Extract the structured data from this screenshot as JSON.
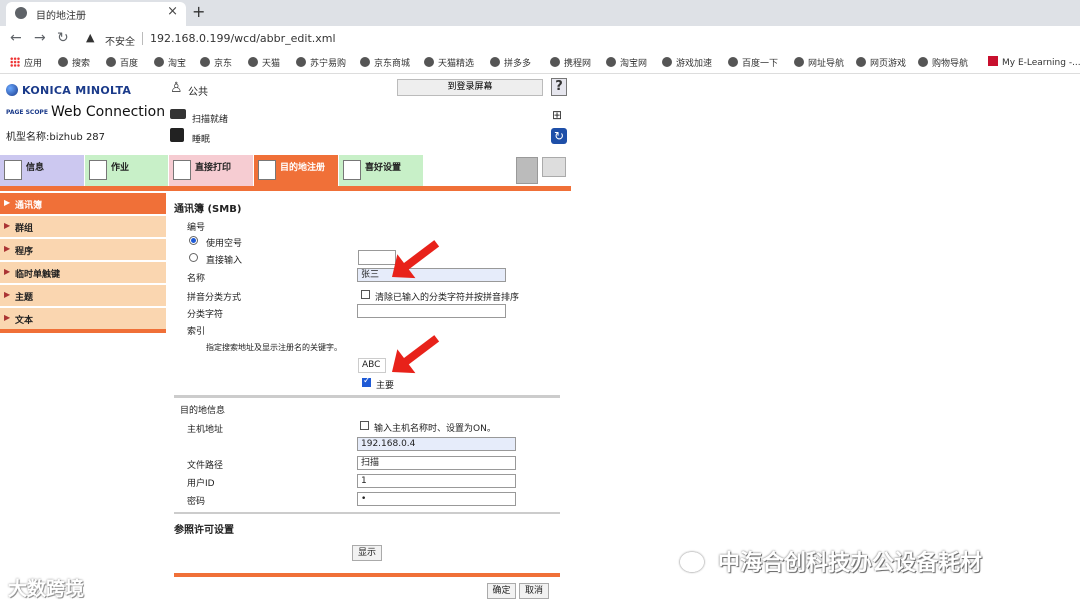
{
  "browser": {
    "tab_title": "目的地注册",
    "tab_close": "×",
    "new_tab": "+",
    "insecure_label": "不安全",
    "url": "192.168.0.199/wcd/abbr_edit.xml",
    "nav": {
      "back": "←",
      "forward": "→",
      "reload": "↻",
      "warning": "▲"
    }
  },
  "bookmarks": [
    {
      "label": "应用",
      "icon": "apps-icon"
    },
    {
      "label": "搜索",
      "icon": "globe-icon"
    },
    {
      "label": "百度",
      "icon": "globe-icon"
    },
    {
      "label": "淘宝",
      "icon": "globe-icon"
    },
    {
      "label": "京东",
      "icon": "globe-icon"
    },
    {
      "label": "天猫",
      "icon": "globe-icon"
    },
    {
      "label": "苏宁易购",
      "icon": "globe-icon"
    },
    {
      "label": "京东商城",
      "icon": "globe-icon"
    },
    {
      "label": "天猫精选",
      "icon": "globe-icon"
    },
    {
      "label": "拼多多",
      "icon": "globe-icon"
    },
    {
      "label": "携程网",
      "icon": "globe-icon"
    },
    {
      "label": "淘宝网",
      "icon": "globe-icon"
    },
    {
      "label": "游戏加速",
      "icon": "globe-icon"
    },
    {
      "label": "百度一下",
      "icon": "globe-icon"
    },
    {
      "label": "网址导航",
      "icon": "globe-icon"
    },
    {
      "label": "网页游戏",
      "icon": "globe-icon"
    },
    {
      "label": "购物导航",
      "icon": "globe-icon"
    },
    {
      "label": "My E-Learning -...",
      "icon": "elearning-icon"
    }
  ],
  "header": {
    "brand": "KONICA MINOLTA",
    "pagescope": "PAGE SCOPE",
    "product": "Web Connection",
    "model": "机型名称:bizhub 287",
    "user": "公共",
    "to_login": "到登录屏幕",
    "help": "?",
    "scan_status": "扫描就绪",
    "print_status": "睡眠"
  },
  "main_tabs": [
    {
      "id": "info",
      "label": "信息"
    },
    {
      "id": "job",
      "label": "作业"
    },
    {
      "id": "print",
      "label": "直接打印"
    },
    {
      "id": "dest",
      "label": "目的地注册"
    },
    {
      "id": "fav",
      "label": "喜好设置"
    }
  ],
  "left_menu": [
    {
      "label": "通讯簿",
      "active": true
    },
    {
      "label": "群组",
      "active": false
    },
    {
      "label": "程序",
      "active": false
    },
    {
      "label": "临时单触键",
      "active": false
    },
    {
      "label": "主题",
      "active": false
    },
    {
      "label": "文本",
      "active": false
    }
  ],
  "form": {
    "title": "通讯簿 (SMB)",
    "number_label": "编号",
    "use_empty_number": "使用空号",
    "direct_input": "直接输入",
    "direct_value": "",
    "name_label": "名称",
    "name_value": "张三",
    "pinyin_label": "拼音分类方式",
    "pinyin_checkbox": "清除已输入的分类字符并按拼音排序",
    "sort_char_label": "分类字符",
    "sort_char_value": "",
    "index_label": "索引",
    "index_hint": "指定搜索地址及显示注册名的关键字。",
    "index_value": "ABC",
    "main_label": "主要",
    "dest_info_label": "目的地信息",
    "host_label": "主机地址",
    "host_checkbox": "输入主机名称时、设置为ON。",
    "host_value": "192.168.0.4",
    "path_label": "文件路径",
    "path_value": "扫描",
    "user_label": "用户ID",
    "user_value": "1",
    "password_label": "密码",
    "password_value": "•",
    "ref_label": "参照许可设置",
    "show_button": "显示",
    "ok_button": "确定",
    "cancel_button": "取消"
  },
  "watermarks": {
    "left": "大数跨境",
    "right": "中海合创科技办公设备耗材"
  },
  "colors": {
    "accent_orange": "#f07038",
    "menu_bg": "#fad6b0",
    "arrow_red": "#e8221a",
    "checkbox_blue": "#1e5ad6"
  }
}
